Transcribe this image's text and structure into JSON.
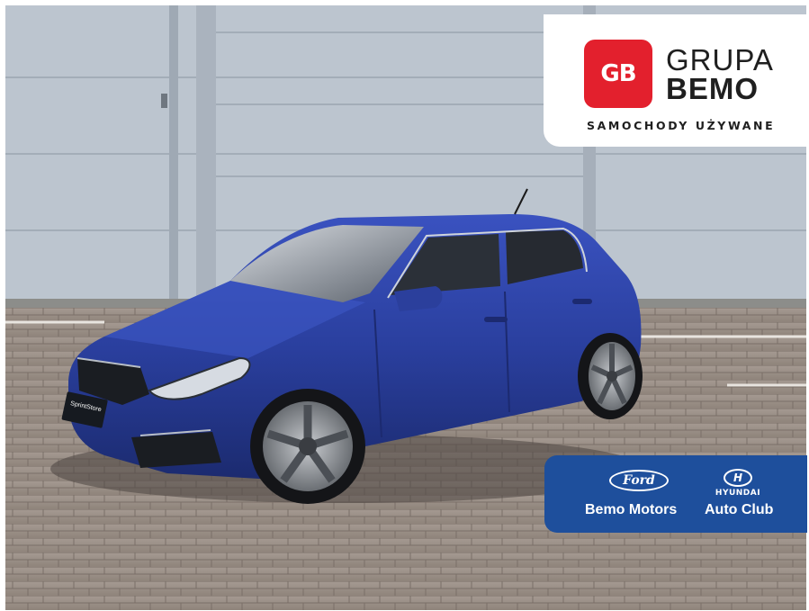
{
  "photo": {
    "subject": "car-photo",
    "colors": {
      "car_body": "#2a3f9e",
      "wall": "#bcc5cf",
      "pavement": "#9c8f86"
    },
    "license_plate_text": "SprintStore"
  },
  "grupa_bemo": {
    "logo_letters": "GB",
    "line1": "GRUPA",
    "line2": "BEMO",
    "subtitle": "SAMOCHODY UŻYWANE",
    "accent_color": "#e3202d"
  },
  "dealer_panel": {
    "ford_logo": "Ford",
    "hyundai_logo": "H",
    "hyundai_word": "HYUNDAI",
    "dealer_left": "Bemo Motors",
    "dealer_right": "Auto Club",
    "panel_color": "#1e4f9c"
  }
}
